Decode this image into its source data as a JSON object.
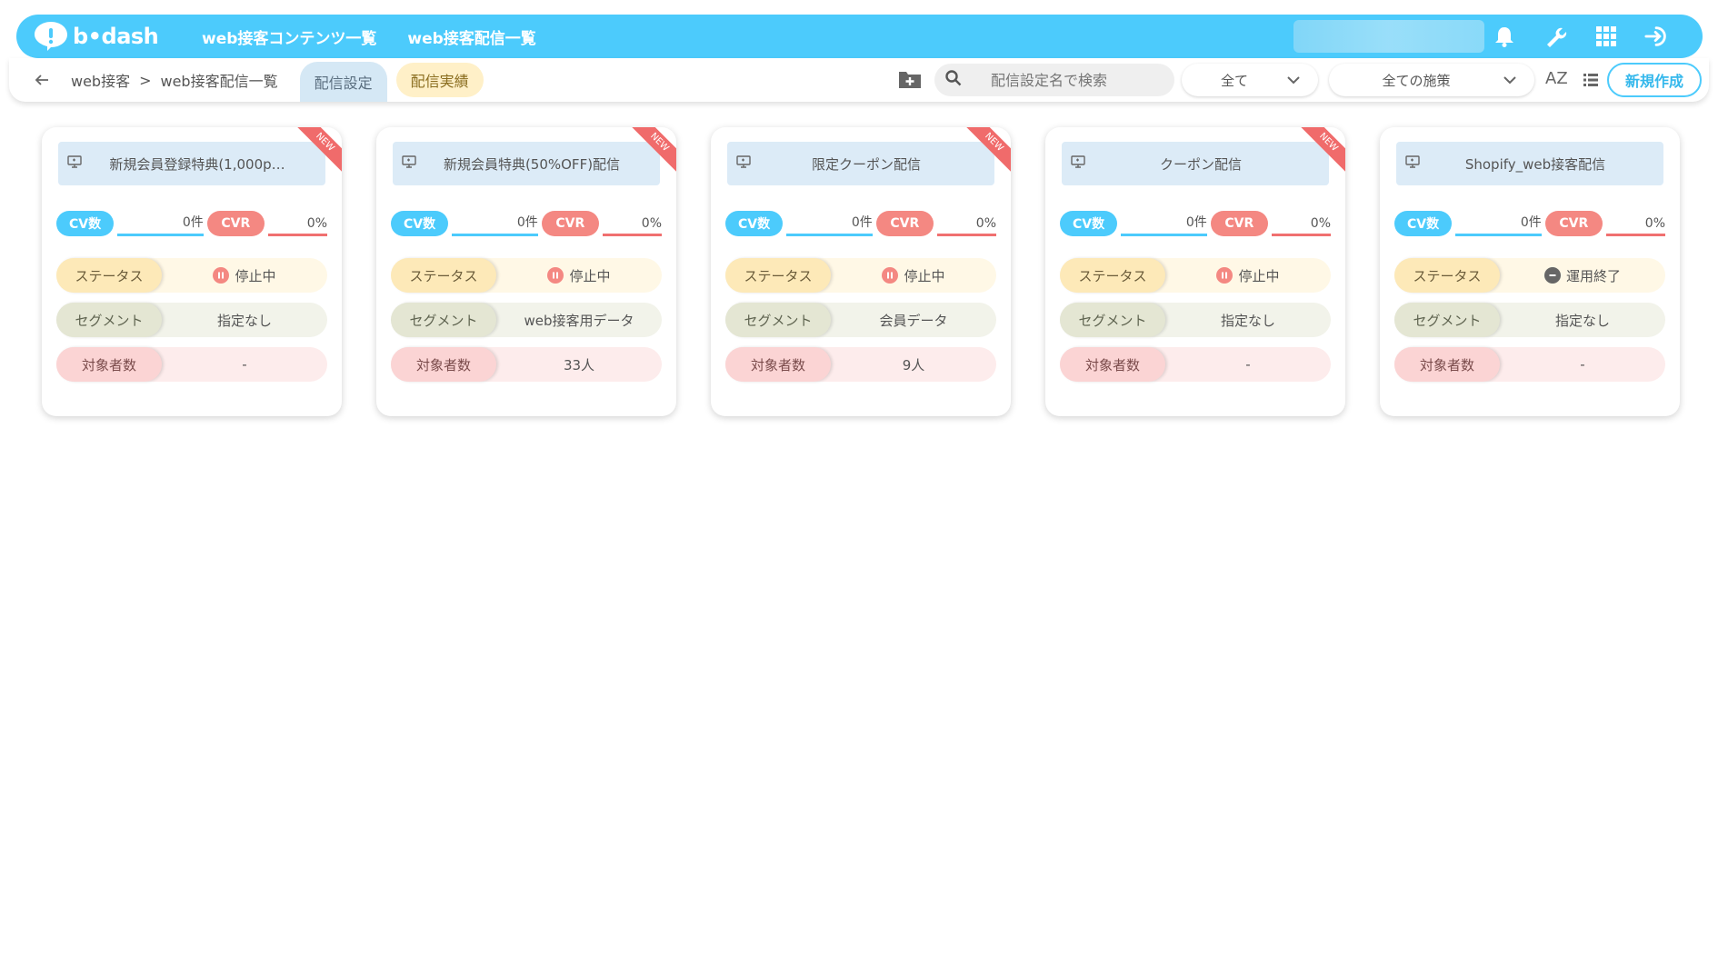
{
  "header": {
    "logo_text": "b•dash",
    "nav": [
      {
        "label": "web接客コンテンツ一覧"
      },
      {
        "label": "web接客配信一覧"
      }
    ]
  },
  "subbar": {
    "breadcrumb": [
      "web接客",
      "web接客配信一覧"
    ],
    "breadcrumb_sep": ">",
    "tabs": [
      {
        "label": "配信設定",
        "active": true
      },
      {
        "label": "配信実績",
        "active": false
      }
    ],
    "search_placeholder": "配信設定名で検索",
    "filter_all": "全て",
    "filter_measure": "全ての施策",
    "sort_label": "AZ",
    "new_button": "新規作成"
  },
  "labels": {
    "cv": "CV数",
    "cvr": "CVR",
    "status": "ステータス",
    "segment": "セグメント",
    "target": "対象者数",
    "new_ribbon": "NEW"
  },
  "cards": [
    {
      "title": "新規会員登録特典(1,000p…",
      "is_new": true,
      "cv": "0件",
      "cvr": "0%",
      "status": "停止中",
      "status_type": "pause",
      "segment": "指定なし",
      "target": "-"
    },
    {
      "title": "新規会員特典(50%OFF)配信",
      "is_new": true,
      "cv": "0件",
      "cvr": "0%",
      "status": "停止中",
      "status_type": "pause",
      "segment": "web接客用データ",
      "target": "33人"
    },
    {
      "title": "限定クーポン配信",
      "is_new": true,
      "cv": "0件",
      "cvr": "0%",
      "status": "停止中",
      "status_type": "pause",
      "segment": "会員データ",
      "target": "9人"
    },
    {
      "title": "クーポン配信",
      "is_new": true,
      "cv": "0件",
      "cvr": "0%",
      "status": "停止中",
      "status_type": "pause",
      "segment": "指定なし",
      "target": "-"
    },
    {
      "title": "Shopify_web接客配信",
      "is_new": false,
      "cv": "0件",
      "cvr": "0%",
      "status": "運用終了",
      "status_type": "end",
      "segment": "指定なし",
      "target": "-"
    }
  ],
  "colors": {
    "accent": "#4ccbfc",
    "cvr": "#f48882",
    "ribbon": "#f06b6b"
  }
}
